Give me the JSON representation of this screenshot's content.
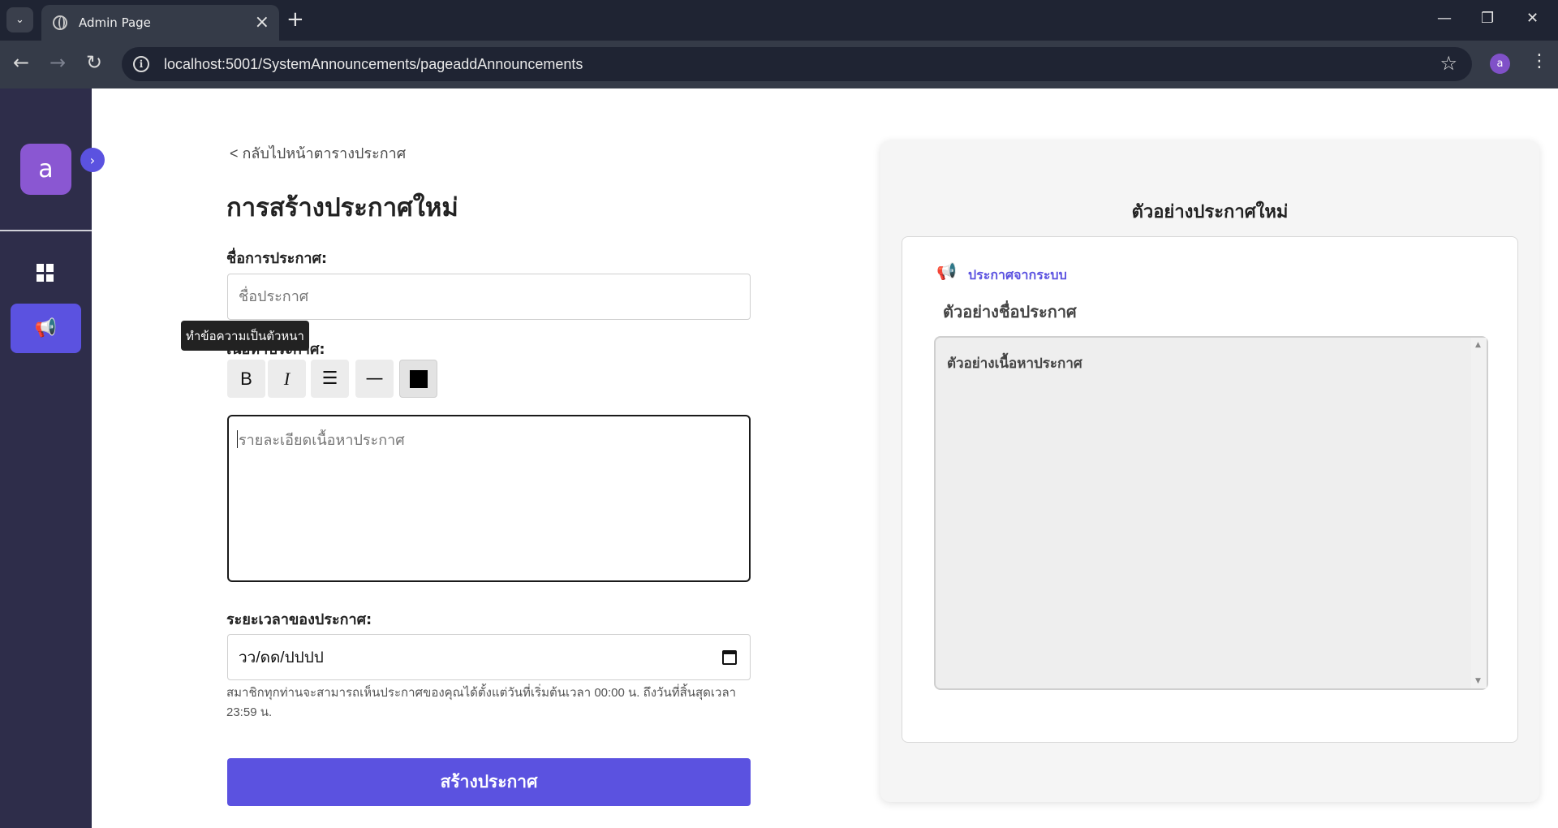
{
  "browser": {
    "tab_title": "Admin Page",
    "url": "localhost:5001/SystemAnnouncements/pageaddAnnouncements",
    "profile_initial": "a"
  },
  "sidebar": {
    "avatar_initial": "a",
    "items": [
      {
        "name": "dashboard",
        "icon": "dashboard-icon",
        "active": false
      },
      {
        "name": "announcements",
        "icon": "megaphone-icon",
        "active": true
      }
    ],
    "accent_color": "#5b52e0"
  },
  "form": {
    "back_link": "< กลับไปหน้าตารางประกาศ",
    "title": "การสร้างประกาศใหม่",
    "name_label": "ชื่อการประกาศ:",
    "name_placeholder": "ชื่อประกาศ",
    "content_label": "เนื้อหาประกาศ:",
    "tooltip": "ทำข้อความเป็นตัวหนา",
    "format_buttons": [
      {
        "name": "bold",
        "glyph": "B"
      },
      {
        "name": "italic",
        "glyph": "I"
      },
      {
        "name": "bullet-list",
        "glyph": "☰"
      },
      {
        "name": "horizontal-rule",
        "glyph": "—"
      },
      {
        "name": "text-color",
        "color": "#000000"
      }
    ],
    "content_placeholder": "รายละเอียดเนื้อหาประกาศ",
    "duration_label": "ระยะเวลาของประกาศ:",
    "date_placeholder": "วว/ดด/ปปปป",
    "help_text": "สมาชิกทุกท่านจะสามารถเห็นประกาศของคุณได้ตั้งแต่วันที่เริ่มต้นเวลา 00:00 น. ถึงวันที่สิ้นสุดเวลา 23:59 น.",
    "submit_label": "สร้างประกาศ"
  },
  "preview": {
    "heading": "ตัวอย่างประกาศใหม่",
    "source_label": "ประกาศจากระบบ",
    "title": "ตัวอย่างชื่อประกาศ",
    "body": "ตัวอย่างเนื้อหาประกาศ"
  }
}
